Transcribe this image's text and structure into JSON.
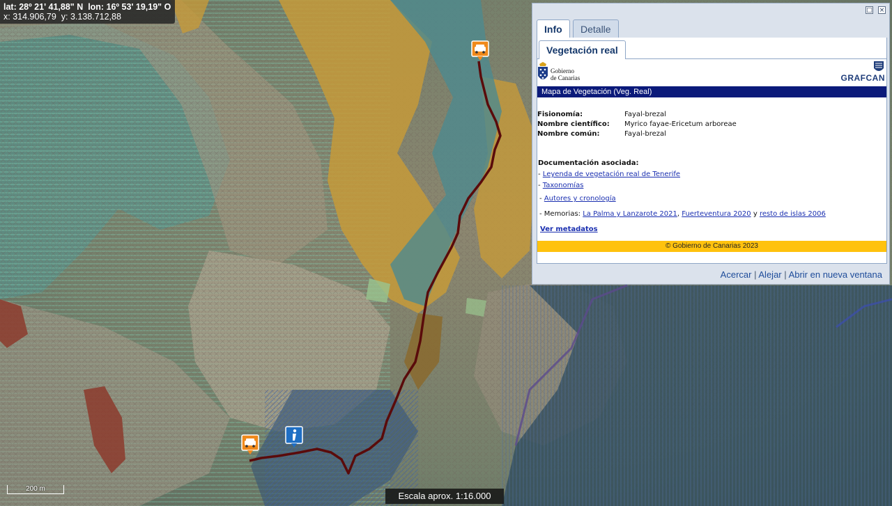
{
  "coords": {
    "lat_label": "lat:",
    "lat_value": "28º 21' 41,88\" N",
    "lon_label": "lon:",
    "lon_value": "16º 53' 19,19\" O",
    "x_label": "x:",
    "x_value": "314.906,79",
    "y_label": "y:",
    "y_value": "3.138.712,88"
  },
  "scalebar": {
    "label": "200 m"
  },
  "scale_text": "Escala aprox. 1:16.000",
  "colors": {
    "track": "#5a0b0b",
    "marker_orange": "#f08a1c",
    "marker_info": "#1f6fc4",
    "title_bar": "#0b1a7a",
    "footer_bar": "#ffc20e"
  },
  "panel": {
    "tabs": [
      "Info",
      "Detalle"
    ],
    "active_tab": "Info",
    "subtab": "Vegetación real",
    "logo_gob": "Gobierno de Canarias",
    "logo_gob_line1": "Gobierno",
    "logo_gob_line2": "de Canarias",
    "logo_graf": "GRAFCAN",
    "title": "Mapa de Vegetación (Veg. Real)",
    "attributes": [
      {
        "label": "Fisionomía:",
        "value": "Fayal-brezal"
      },
      {
        "label": "Nombre científico:",
        "value": "Myrico fayae-Ericetum arboreae"
      },
      {
        "label": "Nombre común:",
        "value": "Fayal-brezal"
      }
    ],
    "docs_heading": "Documentación asociada:",
    "doc_links": [
      "Leyenda de vegetación real de Tenerife",
      "Taxonomías",
      "Autores y cronología"
    ],
    "memorias_label": "- Memorias:",
    "memorias": [
      "La Palma y Lanzarote 2021",
      "Fuerteventura 2020",
      "resto de islas 2006"
    ],
    "memorias_sep1": ",",
    "memorias_sep2": "y",
    "metadata_link": "Ver metadatos",
    "copyright": "© Gobierno de Canarias 2023",
    "actions": [
      "Acercar",
      "Alejar",
      "Abrir en nueva ventana"
    ],
    "action_sep": "|",
    "maximize_icon": "maximize-icon",
    "close_icon": "close-icon"
  },
  "markers": [
    {
      "name": "car-marker-top",
      "icon": "car-icon"
    },
    {
      "name": "car-marker-bottom",
      "icon": "car-icon"
    },
    {
      "name": "info-marker",
      "icon": "info-icon"
    }
  ]
}
